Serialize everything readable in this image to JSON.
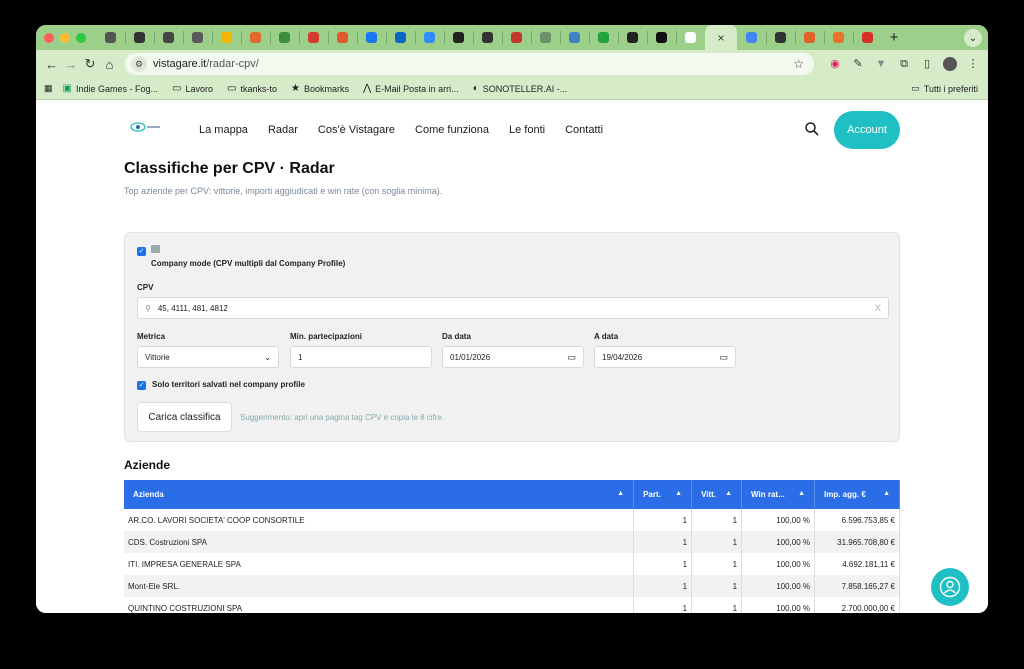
{
  "browser": {
    "tab_colors": [
      "#555555",
      "#333333",
      "#444444",
      "#5a5a5a",
      "#f4b400",
      "#e36a2e",
      "#3c8d3c",
      "#d33b2c",
      "#e05a2b",
      "#1877f2",
      "#0a66c2",
      "#2f8cff",
      "#222222",
      "#333333",
      "#c0392b",
      "#6b8f6b",
      "#3d84c6",
      "#1fa33a",
      "#222222",
      "#111111",
      "#ffffff",
      "#ffffff"
    ],
    "active_tab_close": "×",
    "new_tab_label": "+",
    "url_domain": "vistagare.it",
    "url_path": "/radar-cpv/",
    "bookmarks": [
      {
        "icon": "sheets-icon",
        "label": "Indie Games - Fog..."
      },
      {
        "icon": "folder-icon",
        "label": "Lavoro"
      },
      {
        "icon": "folder-icon",
        "label": "tkanks-to"
      },
      {
        "icon": "star-icon",
        "label": "Bookmarks"
      },
      {
        "icon": "mail-icon",
        "label": "E-Mail Posta in arri..."
      },
      {
        "icon": "sono-icon",
        "label": "SONOTELLER.AI -..."
      }
    ],
    "other_bookmarks": "Tutti i preferiti"
  },
  "site": {
    "nav": [
      "La mappa",
      "Radar",
      "Cos'è Vistagare",
      "Come funziona",
      "Le fonti",
      "Contatti"
    ],
    "account_label": "Account",
    "accent": "#1fbfc3"
  },
  "page": {
    "title": "Classifiche per CPV · Radar",
    "subtitle": "Top aziende per CPV: vittorie, importi aggiudicati e win rate (con soglia minima).",
    "company_mode_label": "Company mode (CPV multipli dal Company Profile)",
    "cpv_label": "CPV",
    "cpv_value": "45, 4111, 481, 4812",
    "metric_label": "Metrica",
    "metric_value": "Vittorie",
    "minpart_label": "Min. partecipazioni",
    "minpart_value": "1",
    "from_label": "Da data",
    "from_value": "01/01/2026",
    "to_label": "A data",
    "to_value": "19/04/2026",
    "territories_label": "Solo territori salvati nel company profile",
    "load_button": "Carica classifica",
    "suggestion": "Suggerimento: apri una pagina tag CPV e copia le 8 cifre.",
    "section_title": "Aziende"
  },
  "table": {
    "headers": [
      "Azienda",
      "Part.",
      "Vitt.",
      "Win rat...",
      "Imp. agg. €"
    ],
    "rows": [
      [
        "AR.CO. LAVORI SOCIETA' COOP CONSORTILE",
        "1",
        "1",
        "100,00 %",
        "6.596.753,85 €"
      ],
      [
        "CDS. Costruzioni SPA",
        "1",
        "1",
        "100,00 %",
        "31.965.708,80 €"
      ],
      [
        "ITI. IMPRESA GENERALE SPA",
        "1",
        "1",
        "100,00 %",
        "4.692.181,11 €"
      ],
      [
        "Mont-Ele SRL.",
        "1",
        "1",
        "100,00 %",
        "7.858.165,27 €"
      ],
      [
        "QUINTINO COSTRUZIONI SPA",
        "1",
        "1",
        "100,00 %",
        "2.700.000,00 €"
      ]
    ]
  }
}
